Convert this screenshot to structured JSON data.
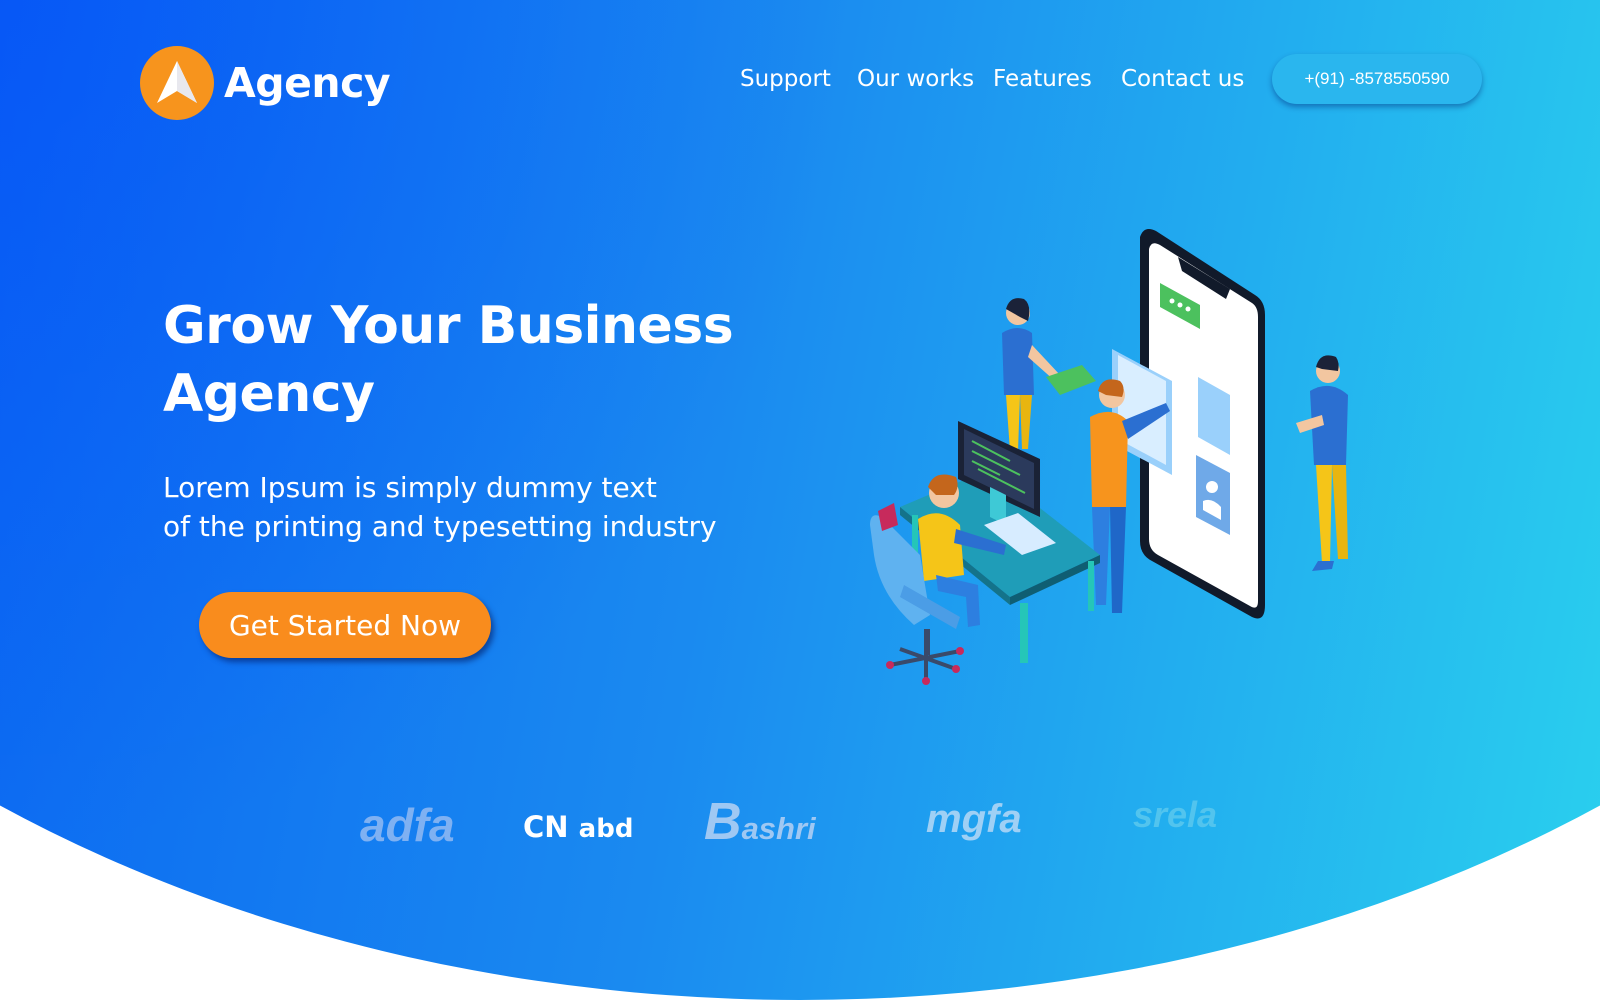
{
  "header": {
    "logo_text": "Agency",
    "nav": [
      {
        "label": "Support"
      },
      {
        "label": "Our works"
      },
      {
        "label": "Features"
      },
      {
        "label": "Contact us"
      }
    ],
    "phone": "+(91) -8578550590"
  },
  "hero": {
    "title_line1": "Grow Your Business",
    "title_line2": "Agency",
    "subtitle_line1": "Lorem Ipsum is simply dummy text",
    "subtitle_line2": "of the printing and typesetting industry",
    "cta_label": "Get Started Now"
  },
  "brands": {
    "b1": "adfa",
    "b2_prefix": "CN",
    "b2_word": "abd",
    "b3_initial": "B",
    "b3_rest": "ashri",
    "b4": "mgfa",
    "b5": "srela"
  },
  "colors": {
    "gradient_start": "#0a66f2",
    "gradient_end": "#2ad0ee",
    "accent_orange": "#f98c1d",
    "phone_button": "#2ab6ee"
  },
  "icons": {
    "logo": "arrow-up-icon",
    "illustration": "team-smartphone-illustration"
  }
}
